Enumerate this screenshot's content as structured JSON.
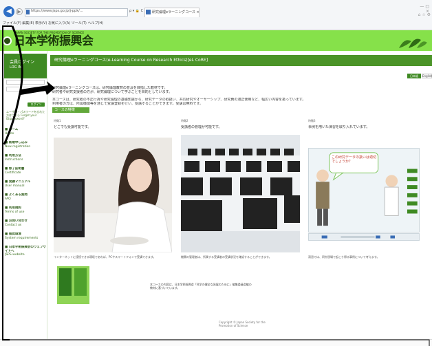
{
  "browser": {
    "back_icon": "back-arrow-icon",
    "forward_icon": "forward-arrow-icon",
    "address": "https://www.jsps.go.jp/j-ppk/...",
    "address_tools": "ρ ▾ 🔒 C",
    "tab_label": "研究倫理eラーニングコース",
    "tab_close": "×",
    "window_controls": "— □ ×",
    "right_tools": "⌂ ☆ ⚙",
    "menu": [
      "ファイル(F)",
      "編集(E)",
      "表示(V)",
      "お気に入り(A)",
      "ツール(T)",
      "ヘルプ(H)"
    ]
  },
  "header": {
    "org_en": "JAPAN SOCIETY FOR THE PROMOTION OF SCIENCE",
    "org_jp": "日本学術振興会"
  },
  "sidebar": {
    "login_title": "会員ログイン",
    "login_sub": "LOG IN",
    "login_button": "ログイン",
    "forgot_text": "ユーザID・パスワードを忘れた方はこちら Forgot your ID/password?",
    "items": [
      {
        "jp": "■ ホーム",
        "en": "Home"
      },
      {
        "jp": "■ 新規申し込み",
        "en": "New registration"
      },
      {
        "jp": "■ 利用方法",
        "en": "Instructions"
      },
      {
        "jp": "■ 修了証明書",
        "en": "Certificate"
      },
      {
        "jp": "■ 受講マニュアル",
        "en": "User manual"
      },
      {
        "jp": "■ よくある質問",
        "en": "FAQ"
      },
      {
        "jp": "■ 利用規約",
        "en": "Terms of use"
      },
      {
        "jp": "■ お問い合わせ",
        "en": "Contact us"
      },
      {
        "jp": "■ 推奨環境",
        "en": "System requirements"
      },
      {
        "jp": "■ 日本学術振興会のウェブサイトへ",
        "en": "JSPS website"
      }
    ]
  },
  "main": {
    "title": "研究倫理eラーニングコース(e-Learning Course on Research Ethics)[eL CoRE]",
    "lang_jp": "日本語",
    "lang_en": "English",
    "intro": [
      "研究倫理eラーニングコースは、研究倫理教育の普及を目指した教材です。",
      "研究者や研究支援者の方が、研究倫理について学ぶことを目的としています。",
      "本コースは、研究者の不正行為や研究倫理の基礎知識から、研究データの取扱い、共同研究やオーサーシップ、研究費の適正使用など、幅広い内容を扱っています。",
      "利用者の方は、所属機関等を通じて受講登録を行い、受講することができます。受講は無料です。"
    ],
    "section_tag": "コースの特徴",
    "columns": [
      {
        "small": "特徴1",
        "title": "どこでも受講可能です。",
        "caption": "インターネットに接続できる環境であれば、PCやスマートフォンで受講できます。"
      },
      {
        "small": "特徴2",
        "title": "受講者の管理が可能です。",
        "caption": "機関の管理者は、所属する受講者の受講状況を確認することができます。"
      },
      {
        "small": "特徴3",
        "title": "事例を用いた演習を取り入れています。",
        "caption": "演習では、研究現場で起こり得る事例について考えます。"
      }
    ],
    "bubble_text": "この研究データの扱いは適切でしょうか？",
    "book_text": "本コースの内容は、日本学術振興会「科学の健全な発展のために」編集委員会編の教材に基づいています。",
    "footer": "Copyright © Japan Society for the Promotion of Science"
  },
  "colors": {
    "green": "#86e14a",
    "dark_green": "#3f8a23",
    "accent": "#62a83a"
  }
}
